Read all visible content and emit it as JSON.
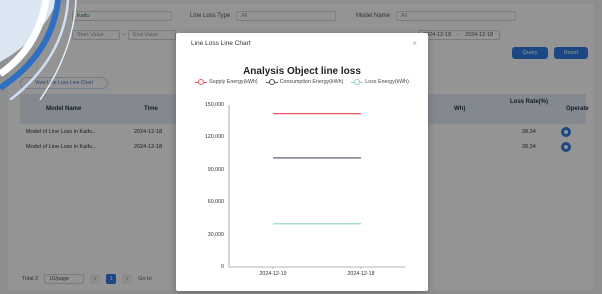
{
  "filters": {
    "org_label": "Kaifu",
    "line_loss_type_label": "Line Loss Type",
    "line_loss_type_value": "All",
    "model_name_label": "Model Name",
    "model_name_value": "All",
    "start_placeholder": "Start Value",
    "end_placeholder": "End Value",
    "date_start": "2024-12-18",
    "date_sep": "-",
    "date_end": "2024-12-18",
    "query_label": "Query",
    "reset_label": "Reset"
  },
  "view_chart_button": "View Line Loss Line Chart",
  "table": {
    "headers": [
      "Model Name",
      "Time",
      "Wh)",
      "Loss Rate(%)",
      "Operate"
    ],
    "rows": [
      {
        "model": "Model of Line Loss in Kaifu...",
        "time": "2024-12-18",
        "rate": "28.34"
      },
      {
        "model": "Model of Line Loss in Kaifu...",
        "time": "2024-12-18",
        "rate": "28.34"
      }
    ]
  },
  "pagination": {
    "total": "Total 2",
    "page_size": "10/page",
    "current_page": "1",
    "goto": "Go to"
  },
  "modal": {
    "title": "Line Loss Line Chart",
    "close": "×"
  },
  "colors": {
    "primary": "#2f7de1",
    "supply": "#e8585d",
    "consumption": "#4b5566",
    "loss": "#8fd4c5"
  },
  "chart_data": {
    "type": "line",
    "title": "Analysis Object line loss",
    "categories": [
      "2024-12-19",
      "2024-12-18"
    ],
    "y_ticks": [
      "150,000",
      "120,000",
      "90,000",
      "60,000",
      "30,000",
      "0"
    ],
    "ylim": [
      0,
      150000
    ],
    "legend_position": "top",
    "series": [
      {
        "name": "Supply Energy(kWh)",
        "values": [
          142000,
          142000
        ],
        "color": "#e8585d"
      },
      {
        "name": "Consumption Energy(kWh)",
        "values": [
          101000,
          101000
        ],
        "color": "#4b5566"
      },
      {
        "name": "Loss Energy(kWh)",
        "values": [
          40000,
          40000
        ],
        "color": "#8fd4c5"
      }
    ]
  }
}
